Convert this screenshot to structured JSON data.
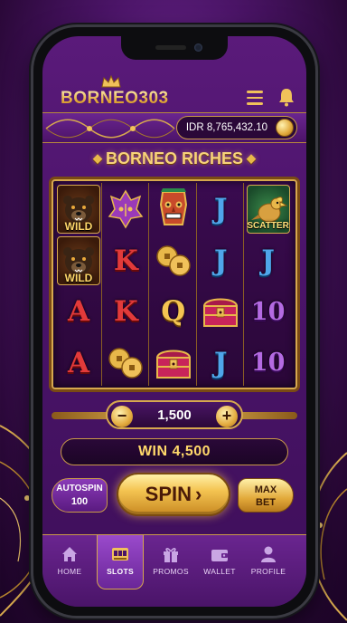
{
  "app": {
    "logo_text": "BORNEO303"
  },
  "header": {
    "balance": "IDR 8,765,432.10"
  },
  "game": {
    "title": "BORNEO RICHES"
  },
  "reels": [
    [
      {
        "type": "bear",
        "label": "WILD"
      },
      {
        "type": "bear",
        "label": "WILD"
      },
      {
        "type": "card",
        "text": "A",
        "color": "red"
      },
      {
        "type": "card",
        "text": "A",
        "color": "red"
      }
    ],
    [
      {
        "type": "mask-purple"
      },
      {
        "type": "card",
        "text": "K",
        "color": "red"
      },
      {
        "type": "card",
        "text": "K",
        "color": "red"
      },
      {
        "type": "coins"
      }
    ],
    [
      {
        "type": "mask-tribal"
      },
      {
        "type": "coins"
      },
      {
        "type": "card",
        "text": "Q",
        "color": "gold"
      },
      {
        "type": "chest"
      }
    ],
    [
      {
        "type": "card",
        "text": "J",
        "color": "blue"
      },
      {
        "type": "card",
        "text": "J",
        "color": "blue"
      },
      {
        "type": "chest"
      },
      {
        "type": "card",
        "text": "J",
        "color": "blue"
      }
    ],
    [
      {
        "type": "hornbill",
        "label": "SCATTER"
      },
      {
        "type": "card",
        "text": "J",
        "color": "blue"
      },
      {
        "type": "card",
        "text": "10",
        "color": "purple"
      },
      {
        "type": "card",
        "text": "10",
        "color": "purple"
      }
    ]
  ],
  "bet": {
    "value": "1,500",
    "minus": "−",
    "plus": "+"
  },
  "win": {
    "text": "WIN 4,500"
  },
  "controls": {
    "autospin_line1": "AUTOSPIN",
    "autospin_line2": "100",
    "spin": "SPIN",
    "maxbet_line1": "MAX",
    "maxbet_line2": "BET"
  },
  "nav": [
    {
      "label": "HOME",
      "icon": "home-icon",
      "active": false
    },
    {
      "label": "SLOTS",
      "icon": "slot-machine-icon",
      "active": true
    },
    {
      "label": "PROMOS",
      "icon": "gift-icon",
      "active": false
    },
    {
      "label": "WALLET",
      "icon": "wallet-icon",
      "active": false
    },
    {
      "label": "PROFILE",
      "icon": "profile-icon",
      "active": false
    }
  ],
  "colors": {
    "accent_gold": "#f0c15a",
    "bg_purple": "#4b146a"
  }
}
